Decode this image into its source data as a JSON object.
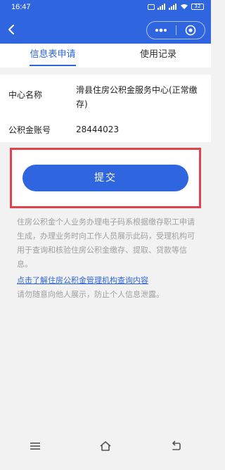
{
  "status_bar": {
    "time": "16:47",
    "battery": "32"
  },
  "tabs": [
    {
      "label": "信息表申请",
      "active": true
    },
    {
      "label": "使用记录",
      "active": false
    }
  ],
  "info": {
    "center_label": "中心名称",
    "center_value": "滑县住房公积金服务中心(正常缴存)",
    "account_label": "公积金账号",
    "account_value": "28444023"
  },
  "submit_label": "提交",
  "notice": {
    "text": "住房公积金个人业务办理电子码系根据缴存职工申请生成，办理业务时向工作人员展示此码，受理机构可用于查询和核验住房公积金缴存、提取、贷款等信息。",
    "link": "点击了解住房公积金管理机构查询内容",
    "warning": "请勿随意向他人展示，防止个人信息泄露。"
  },
  "icons": {
    "back": "back-arrow-icon",
    "more": "more-dots-icon",
    "close": "target-close-icon",
    "menu": "menu-icon",
    "home": "home-icon",
    "return": "return-icon"
  },
  "colors": {
    "primary": "#2f66e0",
    "highlight": "#e0424e"
  }
}
